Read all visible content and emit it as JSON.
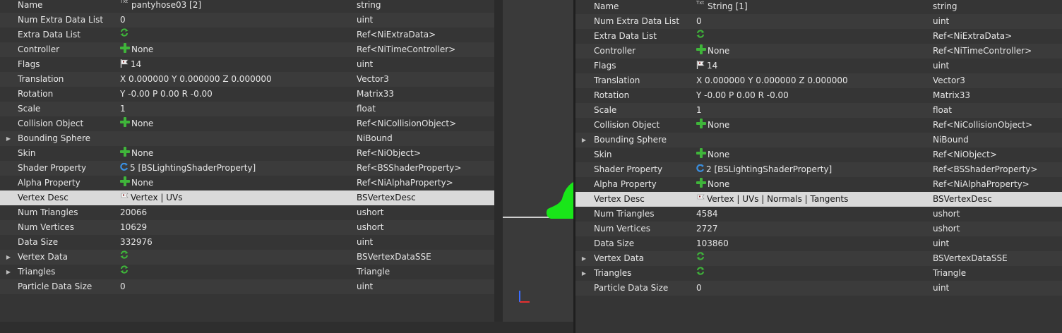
{
  "left_panel": {
    "rows": [
      {
        "name": "Name",
        "value": "pantyhose03 [2]",
        "icon": "txt-icon",
        "type": "string"
      },
      {
        "name": "Num Extra Data List",
        "value": "0",
        "type": "uint"
      },
      {
        "name": "Extra Data List",
        "value": "",
        "icon": "refresh-icon",
        "type": "Ref<NiExtraData>"
      },
      {
        "name": "Controller",
        "value": "None",
        "icon": "plus-icon",
        "type": "Ref<NiTimeController>"
      },
      {
        "name": "Flags",
        "value": "14",
        "icon": "flag-icon",
        "type": "uint"
      },
      {
        "name": "Translation",
        "value": "X 0.000000 Y 0.000000 Z 0.000000",
        "type": "Vector3"
      },
      {
        "name": "Rotation",
        "value": "Y -0.00 P 0.00 R -0.00",
        "type": "Matrix33"
      },
      {
        "name": "Scale",
        "value": "1",
        "type": "float"
      },
      {
        "name": "Collision Object",
        "value": "None",
        "icon": "plus-icon",
        "type": "Ref<NiCollisionObject>"
      },
      {
        "name": "Bounding Sphere",
        "value": "",
        "expandable": true,
        "type": "NiBound"
      },
      {
        "name": "Skin",
        "value": "None",
        "icon": "plus-icon",
        "type": "Ref<NiObject>"
      },
      {
        "name": "Shader Property",
        "value": "5 [BSLightingShaderProperty]",
        "icon": "refresh-blue-icon",
        "type": "Ref<BSShaderProperty>"
      },
      {
        "name": "Alpha Property",
        "value": "None",
        "icon": "plus-icon",
        "type": "Ref<NiAlphaProperty>"
      },
      {
        "name": "Vertex Desc",
        "value": "Vertex | UVs",
        "icon": "flag-icon",
        "type": "BSVertexDesc",
        "selected": true
      },
      {
        "name": "Num Triangles",
        "value": "20066",
        "type": "ushort"
      },
      {
        "name": "Num Vertices",
        "value": "10629",
        "type": "ushort"
      },
      {
        "name": "Data Size",
        "value": "332976",
        "type": "uint"
      },
      {
        "name": "Vertex Data",
        "value": "",
        "icon": "refresh-icon",
        "expandable": true,
        "type": "BSVertexDataSSE"
      },
      {
        "name": "Triangles",
        "value": "",
        "icon": "refresh-icon",
        "expandable": true,
        "type": "Triangle"
      },
      {
        "name": "Particle Data Size",
        "value": "0",
        "type": "uint"
      }
    ]
  },
  "right_panel": {
    "rows": [
      {
        "name": "Name",
        "value": "String [1]",
        "icon": "txt-icon",
        "type": "string"
      },
      {
        "name": "Num Extra Data List",
        "value": "0",
        "type": "uint"
      },
      {
        "name": "Extra Data List",
        "value": "",
        "icon": "refresh-icon",
        "type": "Ref<NiExtraData>"
      },
      {
        "name": "Controller",
        "value": "None",
        "icon": "plus-icon",
        "type": "Ref<NiTimeController>"
      },
      {
        "name": "Flags",
        "value": "14",
        "icon": "flag-icon",
        "type": "uint"
      },
      {
        "name": "Translation",
        "value": "X 0.000000 Y 0.000000 Z 0.000000",
        "type": "Vector3"
      },
      {
        "name": "Rotation",
        "value": "Y -0.00 P 0.00 R -0.00",
        "type": "Matrix33"
      },
      {
        "name": "Scale",
        "value": "1",
        "type": "float"
      },
      {
        "name": "Collision Object",
        "value": "None",
        "icon": "plus-icon",
        "type": "Ref<NiCollisionObject>"
      },
      {
        "name": "Bounding Sphere",
        "value": "",
        "expandable": true,
        "type": "NiBound"
      },
      {
        "name": "Skin",
        "value": "None",
        "icon": "plus-icon",
        "type": "Ref<NiObject>"
      },
      {
        "name": "Shader Property",
        "value": "2 [BSLightingShaderProperty]",
        "icon": "refresh-blue-icon",
        "type": "Ref<BSShaderProperty>"
      },
      {
        "name": "Alpha Property",
        "value": "None",
        "icon": "plus-icon",
        "type": "Ref<NiAlphaProperty>"
      },
      {
        "name": "Vertex Desc",
        "value": "Vertex | UVs | Normals | Tangents",
        "icon": "flag-icon",
        "type": "BSVertexDesc",
        "selected": true
      },
      {
        "name": "Num Triangles",
        "value": "4584",
        "type": "ushort"
      },
      {
        "name": "Num Vertices",
        "value": "2727",
        "type": "ushort"
      },
      {
        "name": "Data Size",
        "value": "103860",
        "type": "uint"
      },
      {
        "name": "Vertex Data",
        "value": "",
        "icon": "refresh-icon",
        "expandable": true,
        "type": "BSVertexDataSSE"
      },
      {
        "name": "Triangles",
        "value": "",
        "icon": "refresh-icon",
        "expandable": true,
        "type": "Triangle"
      },
      {
        "name": "Particle Data Size",
        "value": "0",
        "type": "uint"
      }
    ]
  },
  "icons": {
    "txt_glyph": "Txt",
    "expand_glyph": "▶"
  },
  "colors": {
    "plus_icon": "#3fb53a",
    "refresh_icon": "#3fb53a",
    "refresh_blue_icon": "#3a8fe0",
    "viewport_mesh": "#19e619",
    "selected_row": "#d9d9d9"
  }
}
